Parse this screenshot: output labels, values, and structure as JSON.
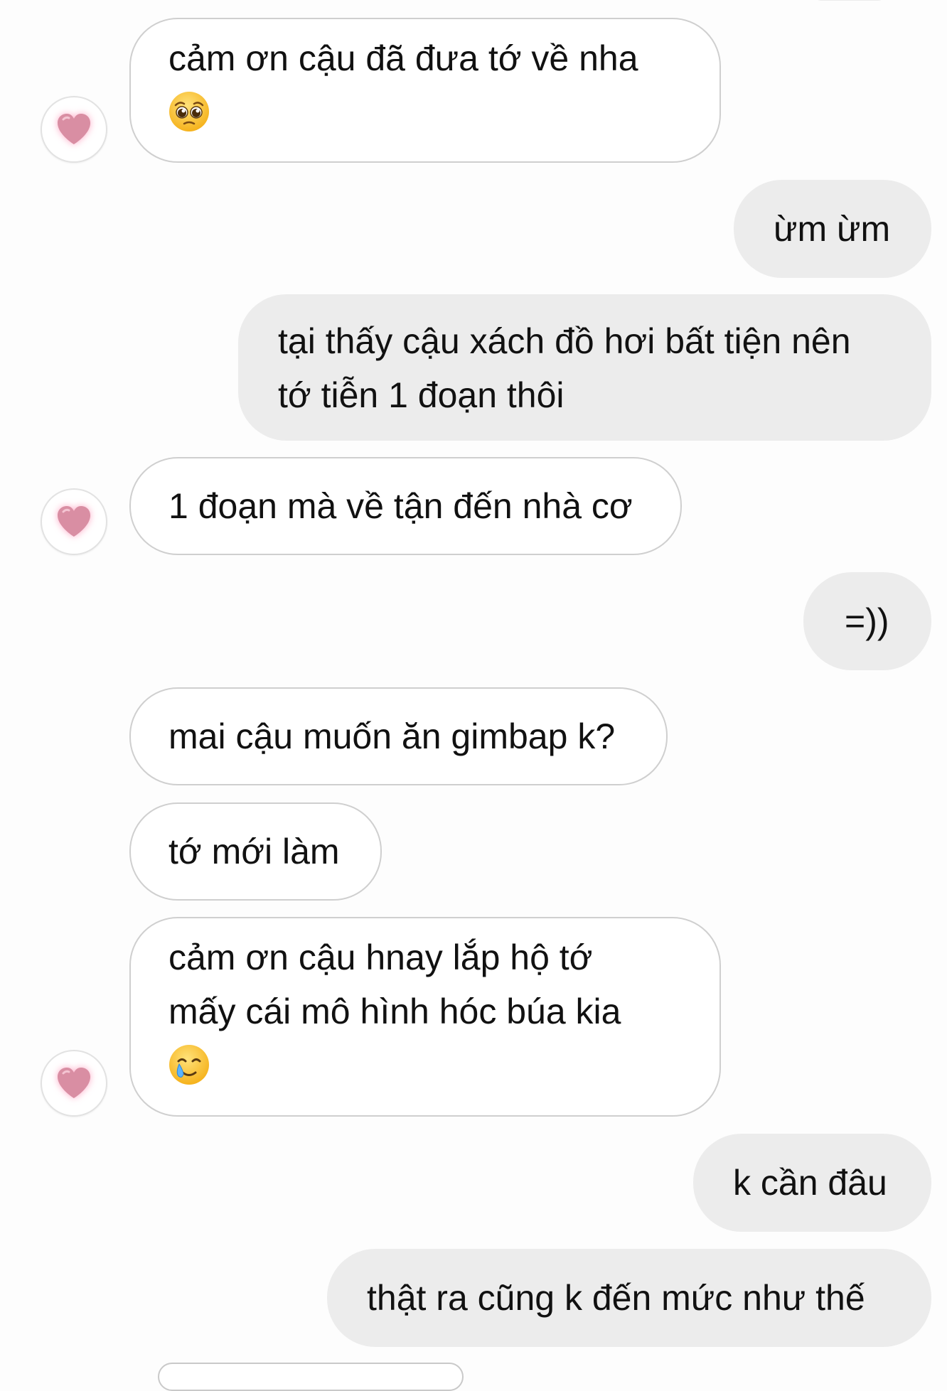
{
  "colors": {
    "page_background": "#fdfdfd",
    "incoming_bubble": "#ffffff",
    "incoming_border": "#cfcfcf",
    "outgoing_bubble": "#ececec",
    "text": "#111111",
    "heart": "#d98ea3"
  },
  "messages": [
    {
      "from": "them",
      "lines": [
        "cảm ơn cậu đã đưa tớ về nha"
      ],
      "emoji": "pleading-face-icon"
    },
    {
      "from": "me",
      "lines": [
        "ừm ừm"
      ]
    },
    {
      "from": "me",
      "lines": [
        "tại thấy cậu xách đồ hơi bất tiện nên",
        "tớ tiễn 1 đoạn thôi"
      ]
    },
    {
      "from": "them",
      "lines": [
        "1 đoạn mà về tận đến nhà cơ"
      ]
    },
    {
      "from": "me",
      "lines": [
        "=))"
      ]
    },
    {
      "from": "them",
      "lines": [
        "mai cậu muốn ăn gimbap k?"
      ]
    },
    {
      "from": "them",
      "lines": [
        "tớ mới làm"
      ]
    },
    {
      "from": "them",
      "lines": [
        "cảm ơn cậu hnay lắp hộ tớ",
        "mấy cái mô hình hóc búa kia"
      ],
      "emoji": "smiling-face-with-tear-icon"
    },
    {
      "from": "me",
      "lines": [
        "k cần đâu"
      ]
    },
    {
      "from": "me",
      "lines": [
        "thật ra cũng k đến mức như thế"
      ]
    }
  ],
  "avatar": {
    "icon": "pink-heart-icon"
  }
}
